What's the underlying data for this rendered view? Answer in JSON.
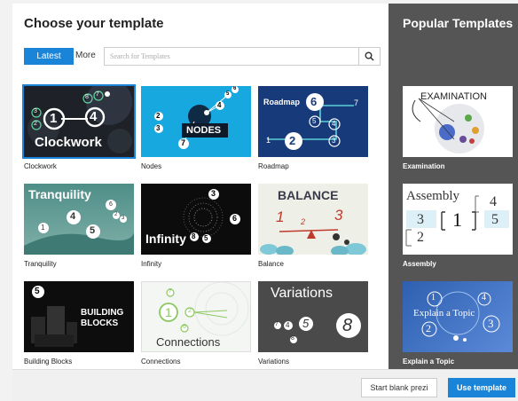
{
  "header": {
    "title": "Choose your template"
  },
  "tabs": {
    "latest": "Latest",
    "more": "More"
  },
  "search": {
    "placeholder": "Search for Templates",
    "icon": "search-icon"
  },
  "templates": [
    {
      "label": "Clockwork",
      "thumb_text": "Clockwork",
      "numbers": [
        "1",
        "4",
        "2",
        "3",
        "8",
        "7"
      ]
    },
    {
      "label": "Nodes",
      "thumb_text": "NODES",
      "numbers": [
        "2",
        "3",
        "4",
        "5",
        "6",
        "7"
      ]
    },
    {
      "label": "Roadmap",
      "thumb_text": "Roadmap",
      "numbers": [
        "6",
        "7",
        "5",
        "4",
        "1",
        "2",
        "3"
      ]
    },
    {
      "label": "Tranquility",
      "thumb_text": "Tranquility",
      "numbers": [
        "4",
        "5",
        "1",
        "6",
        "2",
        "3"
      ]
    },
    {
      "label": "Infinity",
      "thumb_text": "Infinity",
      "numbers": [
        "3",
        "8",
        "6",
        "5"
      ]
    },
    {
      "label": "Balance",
      "thumb_text": "BALANCE",
      "numbers": [
        "1",
        "2",
        "3"
      ]
    },
    {
      "label": "Building Blocks",
      "thumb_text": "BUILDING BLOCKS",
      "numbers": [
        "5"
      ]
    },
    {
      "label": "Connections",
      "thumb_text": "Connections",
      "numbers": [
        "7",
        "1",
        "2",
        "6"
      ]
    },
    {
      "label": "Variations",
      "thumb_text": "Variations",
      "numbers": [
        "7",
        "4",
        "5",
        "8",
        "8"
      ]
    }
  ],
  "popular": {
    "title": "Popular Templates",
    "items": [
      {
        "label": "Examination",
        "thumb_text": "EXAMINATION"
      },
      {
        "label": "Assembly",
        "thumb_text": "Assembly",
        "numbers": [
          "4",
          "3",
          "1",
          "5",
          "2"
        ]
      },
      {
        "label": "Explain a Topic",
        "thumb_text": "Explain a Topic",
        "numbers": [
          "1",
          "4",
          "2",
          "3"
        ]
      }
    ]
  },
  "footer": {
    "blank": "Start blank prezi",
    "use": "Use template"
  },
  "colors": {
    "accent": "#1a84d9",
    "sidebar": "#555555"
  }
}
